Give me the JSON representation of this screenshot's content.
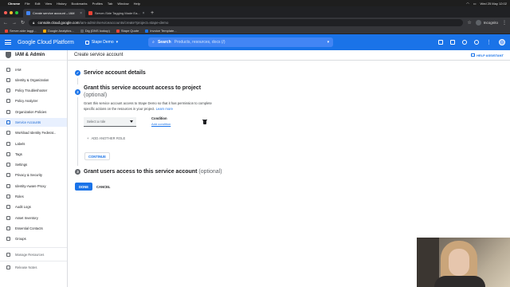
{
  "menubar": {
    "items": [
      "Chrome",
      "File",
      "Edit",
      "View",
      "History",
      "Bookmarks",
      "Profiles",
      "Tab",
      "Window",
      "Help"
    ],
    "clock": "Wed 25 May 12:02"
  },
  "tabs": [
    {
      "title": "Create service account – IAM",
      "active": true,
      "color": "#4285f4"
    },
    {
      "title": "Server-Side Tagging Made Ea...",
      "active": false,
      "color": "#ea4335"
    }
  ],
  "address": {
    "host": "console.cloud.google.com",
    "path": "/iam-admin/serviceaccounts/create?project=stape-demo",
    "profile": "Incognito"
  },
  "bookmarks": [
    {
      "label": "Server-side taggi...",
      "color": "#ea4335"
    },
    {
      "label": "Google Analytics...",
      "color": "#f9ab00"
    },
    {
      "label": "Dig (DNS lookup)",
      "color": "#5f6368"
    },
    {
      "label": "Stape Quote",
      "color": "#ea4335"
    },
    {
      "label": "Invoice Template...",
      "color": "#1a73e8"
    }
  ],
  "gcp": {
    "title": "Google Cloud Platform",
    "project": "Stape Demo",
    "search_label": "Search",
    "search_placeholder": "Products, resources, docs (/)"
  },
  "sidebar": {
    "header": "IAM & Admin",
    "items": [
      {
        "label": "IAM",
        "active": false
      },
      {
        "label": "Identity & Organization",
        "active": false
      },
      {
        "label": "Policy Troubleshooter",
        "active": false
      },
      {
        "label": "Policy Analyzer",
        "active": false
      },
      {
        "label": "Organization Policies",
        "active": false
      },
      {
        "label": "Service Accounts",
        "active": true
      },
      {
        "label": "Workload Identity Federat...",
        "active": false
      },
      {
        "label": "Labels",
        "active": false
      },
      {
        "label": "Tags",
        "active": false
      },
      {
        "label": "Settings",
        "active": false
      },
      {
        "label": "Privacy & Security",
        "active": false
      },
      {
        "label": "Identity-Aware Proxy",
        "active": false
      },
      {
        "label": "Roles",
        "active": false
      },
      {
        "label": "Audit Logs",
        "active": false
      },
      {
        "label": "Asset Inventory",
        "active": false
      },
      {
        "label": "Essential Contacts",
        "active": false
      },
      {
        "label": "Groups",
        "active": false
      }
    ],
    "footer": [
      "Manage Resources",
      "Release Notes"
    ]
  },
  "page": {
    "title": "Create service account",
    "help": "HELP ASSISTANT"
  },
  "steps": {
    "step1": {
      "title": "Service account details"
    },
    "step2": {
      "number": "2",
      "title": "Grant this service account access to project",
      "optional": "(optional)",
      "description": "Grant this service account access to Stape Demo so that it has permission to complete specific actions on the resources in your project.",
      "learn_more": "Learn more",
      "role_placeholder": "Select a role",
      "condition_header": "Condition",
      "add_condition": "Add condition",
      "add_role": "ADD ANOTHER ROLE",
      "continue": "CONTINUE"
    },
    "step3": {
      "number": "3",
      "title": "Grant users access to this service account",
      "optional": "(optional)"
    }
  },
  "actions": {
    "done": "DONE",
    "cancel": "CANCEL"
  }
}
